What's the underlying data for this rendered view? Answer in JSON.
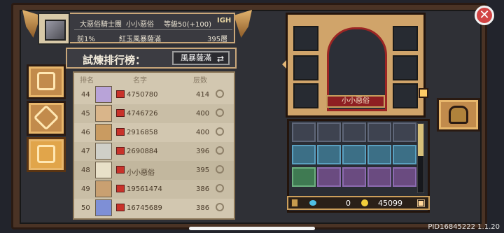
{
  "top_panel": {
    "guild_title": "大惡俗騎士團",
    "player_name": "小小惡俗",
    "level_text": "等級50(+100)",
    "badge": "IGH",
    "percentile": "前1%",
    "faction_text": "紅玉風暴薩滿",
    "floor_text": "395層"
  },
  "trial": {
    "title": "試煉排行榜：",
    "mode": "風暴薩滿"
  },
  "leaderboard": {
    "headers": [
      "排名",
      "名字",
      "层数"
    ],
    "rows": [
      {
        "rank": "44",
        "name": "4750780",
        "floor": "414"
      },
      {
        "rank": "45",
        "name": "4746726",
        "floor": "400"
      },
      {
        "rank": "46",
        "name": "2916858",
        "floor": "400"
      },
      {
        "rank": "47",
        "name": "2690884",
        "floor": "396"
      },
      {
        "rank": "48",
        "name": "小小惡俗",
        "floor": "395"
      },
      {
        "rank": "49",
        "name": "19561474",
        "floor": "386"
      },
      {
        "rank": "50",
        "name": "16745689",
        "floor": "386"
      }
    ]
  },
  "hero": {
    "name": "小小惡俗"
  },
  "inventory": {
    "gems": "0",
    "gold": "45099"
  },
  "footer": {
    "pid": "PID16845222 1.1.20"
  },
  "icons": {
    "close": "close-icon",
    "leaf": "leaf-icon",
    "diamond": "diamond-icon",
    "podium": "podium-icon",
    "helmet": "helmet-icon",
    "swap": "swap-icon",
    "search": "search-icon",
    "gem": "gem-icon",
    "coin": "coin-icon",
    "lock": "lock-icon",
    "plus": "plus-icon"
  },
  "colors": {
    "frame": "#4a3325",
    "panel": "#2f3036",
    "accent": "#c9a77a",
    "board": "#d2c7b0",
    "hero_bg": "#d0a46a",
    "close_red": "#d14444"
  }
}
